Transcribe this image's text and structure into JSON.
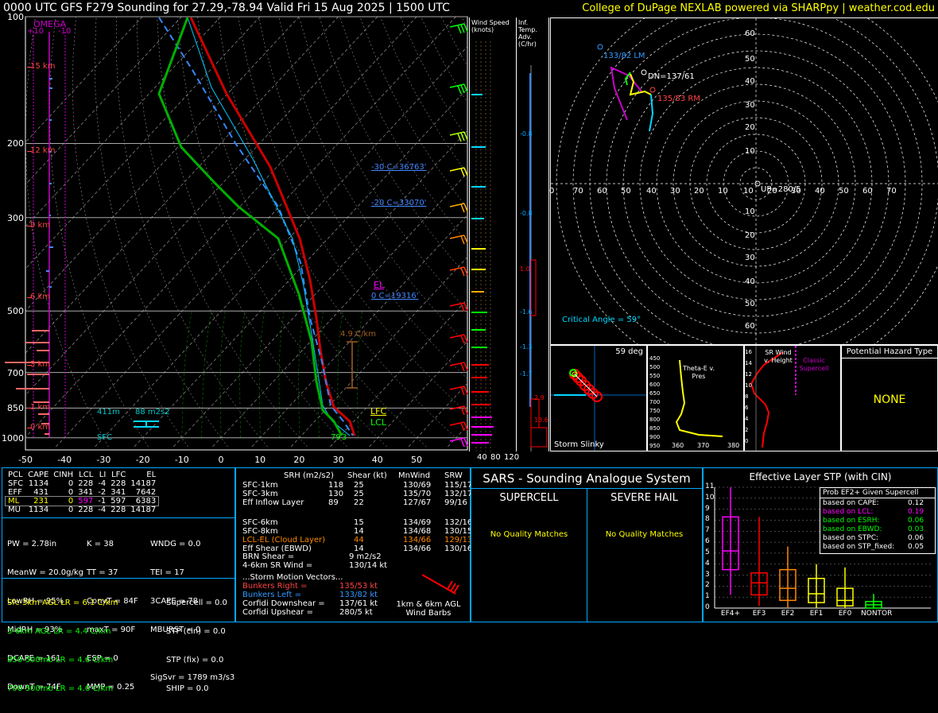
{
  "header": {
    "title": "0000 UTC GFS F279 Sounding for 27.29,-78.94 Valid  Fri 15 Aug 2025 | 1500 UTC",
    "credit": "College of DuPage NEXLAB powered via SHARPpy | weather.cod.edu"
  },
  "skewt": {
    "pressure_labels": [
      "100",
      "200",
      "300",
      "500",
      "700",
      "850",
      "1000"
    ],
    "temp_labels": [
      "-50",
      "-40",
      "-30",
      "-20",
      "-10",
      "0",
      "10",
      "20",
      "30",
      "40",
      "50"
    ],
    "omega": {
      "title": "OMEGA",
      "left": "+10",
      "right": "-10"
    },
    "height_labels": [
      "15 km",
      "12 km",
      "9 km",
      "6 km",
      "3 km",
      "1 km",
      "0 km"
    ],
    "annotations": {
      "m30": "-30 C=36763'",
      "m20": "-20 C=33070'",
      "zero": "0 C=19316'",
      "el": "EL",
      "lfc": "LFC",
      "lcl": "LCL",
      "lapse": "4.9 C/km",
      "height411": "411m",
      "srh": "88 m2s2",
      "sfc": "SFC",
      "sfc_temp": "79",
      "sfc_dew": "3"
    }
  },
  "chart_data": [
    {
      "type": "line",
      "title": "",
      "xlabel": "",
      "ylabel": "",
      "xlim": [
        -50,
        50
      ],
      "y_scale": "log-pressure",
      "ylim": [
        1000,
        100
      ],
      "series": [
        {
          "name": "",
          "color": "#cc0000",
          "x": [
            -4,
            20,
            22,
            21,
            12,
            5,
            -4
          ],
          "y": [
            100,
            200,
            350,
            550,
            780,
            920,
            1000
          ]
        },
        {
          "name": "",
          "color": "#00b000",
          "x": [
            -20,
            -24,
            -10,
            8,
            22,
            24,
            20
          ],
          "y": [
            100,
            200,
            300,
            450,
            700,
            900,
            1000
          ]
        }
      ]
    },
    {
      "type": "scatter",
      "title": "Hodograph",
      "x_ticks": [
        "0",
        "70",
        "60",
        "50",
        "40",
        "30",
        "20",
        "10",
        "10",
        "20",
        "30",
        "40",
        "50",
        "60",
        "70"
      ],
      "y_ticks": [
        "60",
        "50",
        "40",
        "30",
        "20",
        "10",
        "10",
        "20",
        "30",
        "40",
        "50",
        "60"
      ],
      "points": [
        {
          "label": "133/82 LM"
        },
        {
          "label": "DN=137/61"
        },
        {
          "label": "135/53 RM"
        },
        {
          "label": "UP=280/5"
        }
      ],
      "critical_angle": "Critical Angle = 59°"
    }
  ],
  "wind_speed": {
    "title": "Wind Speed (knots)",
    "ticks": [
      "40",
      "80",
      "120"
    ]
  },
  "temp_adv": {
    "title": "Inf. Temp. Adv. (C/hr)",
    "values": [
      "-0.8",
      "-0.8",
      "1.0",
      "-1.6",
      "-1.3",
      "-1.7",
      "2.9",
      "13.6"
    ]
  },
  "slinky": {
    "angle": "59 deg",
    "label": "Storm Slinky"
  },
  "theta": {
    "label": "Theta-E v. Pres",
    "ticks": [
      "360",
      "370",
      "380"
    ],
    "yticks": [
      "450",
      "500",
      "550",
      "600",
      "650",
      "700",
      "750",
      "800",
      "850",
      "900",
      "950"
    ]
  },
  "srwind": {
    "label": "SR Wind v. Height",
    "classic": "Classic Supercell",
    "ticks": [
      "16",
      "14",
      "12",
      "10",
      "8",
      "6",
      "4",
      "2",
      "0"
    ]
  },
  "hazard": {
    "title": "Potential Hazard Type",
    "value": "NONE"
  },
  "parcels": {
    "headers": [
      "PCL",
      "CAPE",
      "CINH",
      "LCL",
      "LI",
      "LFC",
      "EL"
    ],
    "rows": [
      [
        "SFC",
        "1134",
        "0",
        "228",
        "-4",
        "228",
        "14187"
      ],
      [
        "EFF",
        "431",
        "0",
        "341",
        "-2",
        "341",
        "7642"
      ],
      [
        "ML",
        "231",
        "0",
        "597",
        "-1",
        "597",
        "6383"
      ],
      [
        "MU",
        "1134",
        "0",
        "228",
        "-4",
        "228",
        "14187"
      ]
    ]
  },
  "thermo": {
    "col1": [
      "PW = 2.78in",
      "MeanW = 20.0g/kg",
      "LowRH = 95%",
      "MidRH = 93%",
      "DCAPE = 161",
      "DownT = 74F"
    ],
    "col2": [
      "K = 38",
      "TT = 37",
      "ConvT = 84F",
      "maxT = 90F",
      "ESP = 0",
      "MMP = 0.25"
    ],
    "col3": [
      "WNDG = 0.0",
      "TEI = 17",
      "3CAPE = 78",
      "MBURST = 0",
      "",
      "SigSvr = 1789 m3/s3"
    ]
  },
  "lapse": [
    "Sfc-3km AGL LR = 6.1 C/km",
    "3-6km AGL LR = 4.4 C/km",
    "850-500mb LR = 4.6 C/km",
    "700-500mb LR = 4.6 C/km"
  ],
  "indices": [
    "Supercell = 0.0",
    "STP (cin) = 0.0",
    "STP (fix) = 0.0",
    "SHIP = 0.0"
  ],
  "kin": {
    "headers": [
      "SRH (m2/s2)",
      "Shear (kt)",
      "MnWind",
      "SRW"
    ],
    "rows": [
      [
        "SFC-1km",
        "118",
        "25",
        "130/69",
        "115/17"
      ],
      [
        "SFC-3km",
        "130",
        "25",
        "135/70",
        "132/17"
      ],
      [
        "Eff Inflow Layer",
        "89",
        "22",
        "127/67",
        "99/16"
      ],
      [
        "",
        "",
        "",
        "",
        ""
      ],
      [
        "SFC-6km",
        "15",
        "134/69",
        "132/16"
      ],
      [
        "SFC-8km",
        "14",
        "134/68",
        "130/15"
      ],
      [
        "LCL-EL (Cloud Layer)",
        "44",
        "134/66",
        "129/13"
      ],
      [
        "Eff Shear (EBWD)",
        "14",
        "134/66",
        "130/16"
      ]
    ],
    "brn": [
      "BRN Shear =",
      "9 m2/s2"
    ],
    "sr46": [
      "4-6km SR Wind =",
      "130/14 kt"
    ],
    "sm_title": "...Storm Motion Vectors...",
    "sm": [
      [
        "Bunkers Right =",
        "135/53 kt"
      ],
      [
        "Bunkers Left =",
        "133/82 kt"
      ],
      [
        "Corfidi Downshear =",
        "137/61 kt"
      ],
      [
        "Corfidi Upshear =",
        "280/5 kt"
      ]
    ],
    "barbs_label": "1km & 6km AGL Wind Barbs"
  },
  "sars": {
    "title": "SARS - Sounding Analogue System",
    "supercell": "SUPERCELL",
    "hail": "SEVERE HAIL",
    "sup_match": "No Quality Matches",
    "hail_match": "No Quality Matches"
  },
  "stp": {
    "title": "Effective Layer STP (with CIN)",
    "y_ticks": [
      "11",
      "10",
      "9",
      "8",
      "7",
      "6",
      "5",
      "4",
      "3",
      "2",
      "1",
      "0"
    ],
    "categories": [
      "EF4+",
      "EF3",
      "EF2",
      "EF1",
      "EF0",
      "NONTOR"
    ],
    "prob_title": "Prob EF2+ Given Supercell",
    "probs": [
      [
        "based on CAPE:",
        "0.12"
      ],
      [
        "based on LCL:",
        "0.19"
      ],
      [
        "based on ESRH:",
        "0.06"
      ],
      [
        "based on EBWD:",
        "0.03"
      ],
      [
        "based on STPC:",
        "0.06"
      ],
      [
        "based on STP_fixed:",
        "0.05"
      ]
    ],
    "box_values": [
      {
        "lo": 1.2,
        "q1": 3.5,
        "med": 5.2,
        "q3": 8.3,
        "hi": 11.0
      },
      {
        "lo": 0.2,
        "q1": 1.2,
        "med": 2.3,
        "q3": 3.2,
        "hi": 8.3
      },
      {
        "lo": 0.0,
        "q1": 0.7,
        "med": 1.8,
        "q3": 3.5,
        "hi": 5.6
      },
      {
        "lo": 0.0,
        "q1": 0.5,
        "med": 1.3,
        "q3": 2.7,
        "hi": 4.0
      },
      {
        "lo": 0.0,
        "q1": 0.2,
        "med": 0.7,
        "q3": 1.8,
        "hi": 3.7
      },
      {
        "lo": 0.0,
        "q1": 0.0,
        "med": 0.3,
        "q3": 0.6,
        "hi": 1.3
      }
    ]
  }
}
